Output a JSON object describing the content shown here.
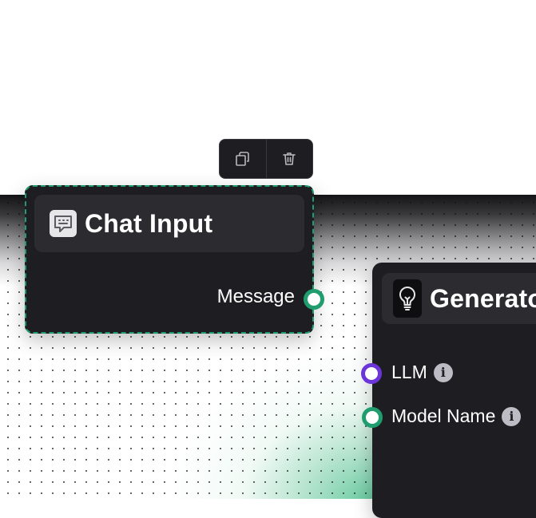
{
  "toolbar": {
    "buttons": [
      {
        "name": "duplicate",
        "icon": "copy-icon"
      },
      {
        "name": "delete",
        "icon": "trash-icon"
      }
    ]
  },
  "nodes": {
    "chat_input": {
      "title": "Chat Input",
      "icon": "chat-icon",
      "selected": true,
      "outputs": [
        {
          "label": "Message",
          "color": "#1f9d6f"
        }
      ]
    },
    "generator": {
      "title": "Generator",
      "icon": "lightbulb-icon",
      "inputs": [
        {
          "label": "LLM",
          "color": "#6b35d9",
          "info_icon": "info-icon"
        },
        {
          "label": "Model Name",
          "color": "#1f9d6f",
          "info_icon": "info-icon"
        }
      ]
    }
  },
  "colors": {
    "node_bg": "#1e1d21",
    "header_bg": "#2c2b30",
    "accent_green": "#1f9d6f",
    "accent_purple": "#6b35d9"
  }
}
